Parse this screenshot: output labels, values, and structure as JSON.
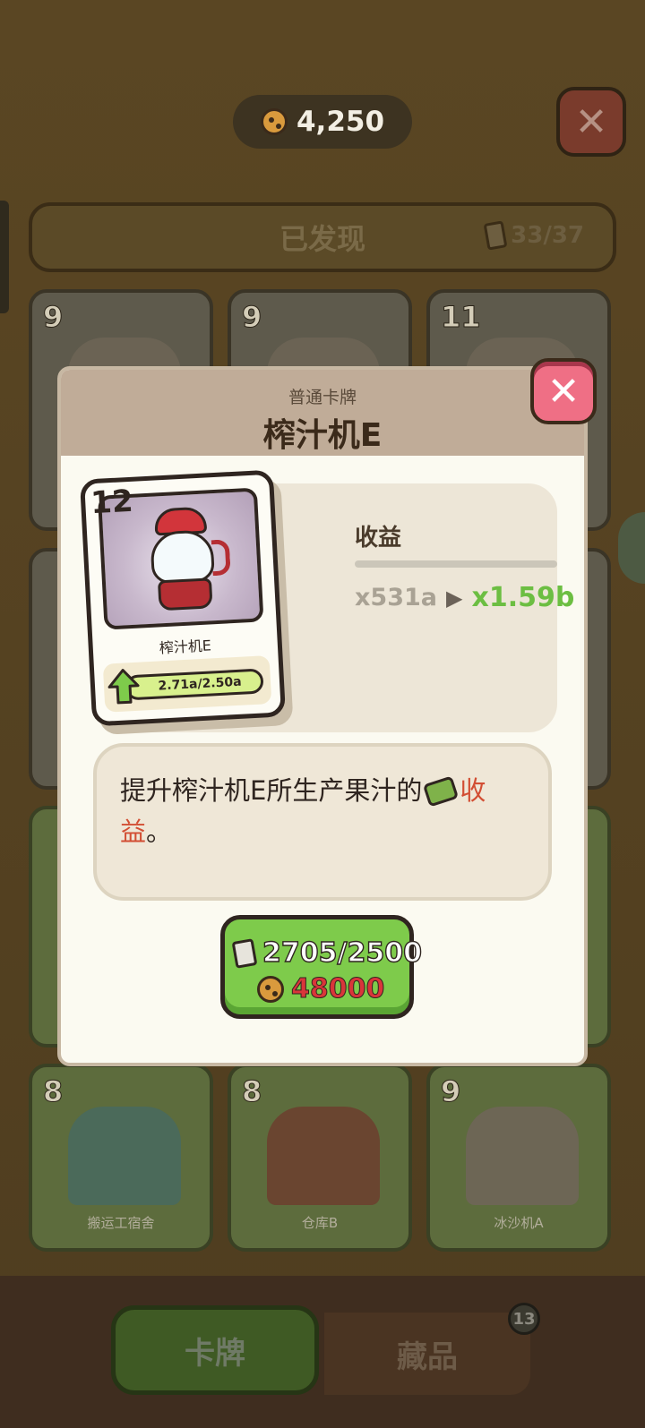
{
  "header": {
    "coins": "4,250",
    "close_label": "✕"
  },
  "discovered_tab": {
    "label": "已发现",
    "count": "33/37"
  },
  "background_cards": [
    {
      "level": "9"
    },
    {
      "level": "9"
    },
    {
      "level": "11"
    },
    {
      "level": "8",
      "name": "搬运工宿舍"
    },
    {
      "level": "8",
      "name": "仓库B"
    },
    {
      "level": "9",
      "name": "冰沙机A"
    }
  ],
  "bottom_tabs": {
    "cards_label": "卡牌",
    "collection_label": "藏品",
    "collection_badge": "13"
  },
  "modal": {
    "subtitle": "普通卡牌",
    "title": "榨汁机E",
    "close_label": "✕",
    "card": {
      "level": "12",
      "name": "榨汁机E",
      "progress": "2.71a/2.50a"
    },
    "stat": {
      "label": "收益",
      "old": "x531a",
      "arrow": "▶",
      "new": "x1.59b"
    },
    "description": {
      "prefix": "提升榨汁机E所生产果汁的",
      "highlight1": "收",
      "highlight2": "益",
      "suffix": "。"
    },
    "upgrade": {
      "cards": "2705/2500",
      "cost": "48000"
    }
  },
  "colors": {
    "accent_green": "#7ecb4b",
    "stat_new": "#6cbe42",
    "highlight": "#d24e33",
    "close_pink": "#ef6f85"
  }
}
